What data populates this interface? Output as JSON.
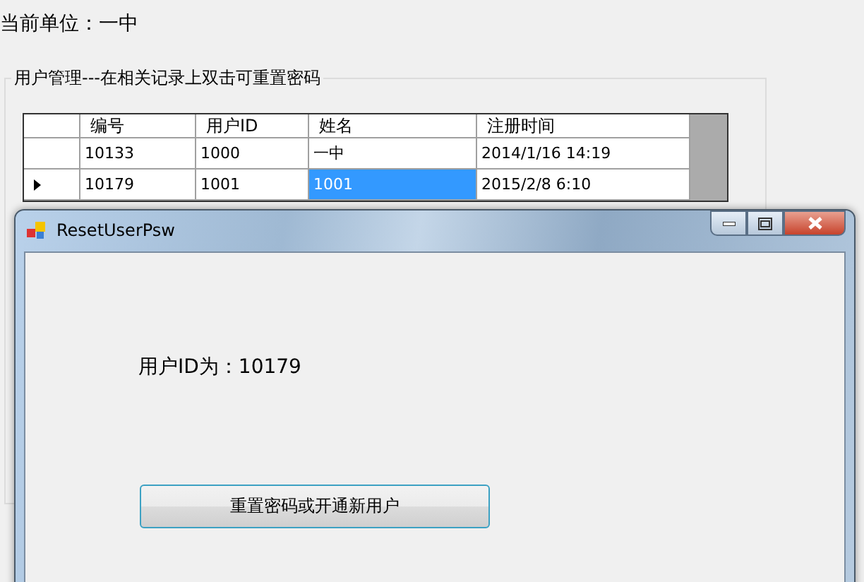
{
  "unit_label": "当前单位：一中",
  "group": {
    "title": "用户管理---在相关记录上双击可重置密码"
  },
  "table": {
    "columns": [
      "编号",
      "用户ID",
      "姓名",
      "注册时间"
    ],
    "rows": [
      {
        "selected": false,
        "cells": [
          {
            "text": "10133",
            "selected": false
          },
          {
            "text": "1000",
            "selected": false
          },
          {
            "text": "一中",
            "selected": false
          },
          {
            "text": "2014/1/16 14:19",
            "selected": false
          }
        ]
      },
      {
        "selected": true,
        "cells": [
          {
            "text": "10179",
            "selected": false
          },
          {
            "text": "1001",
            "selected": false
          },
          {
            "text": "1001",
            "selected": true
          },
          {
            "text": "2015/2/8 6:10",
            "selected": false
          }
        ]
      }
    ]
  },
  "dialog": {
    "title": "ResetUserPsw",
    "user_id_label": "用户ID为：10179",
    "button": "重置密码或开通新用户"
  }
}
